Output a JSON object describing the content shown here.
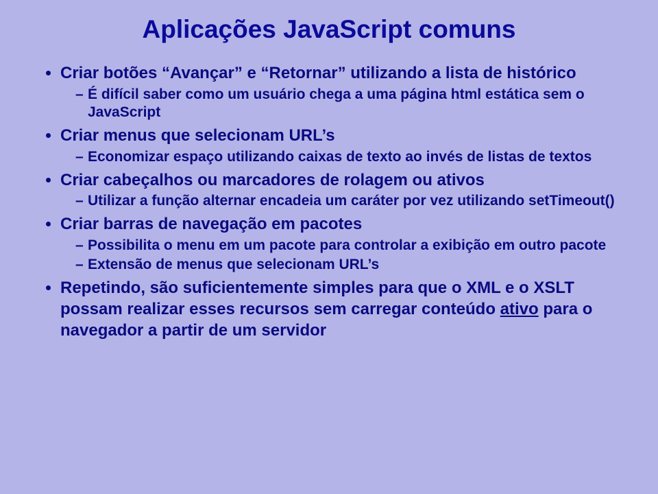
{
  "title": "Aplicações JavaScript comuns",
  "bullets": {
    "b1": {
      "text": "Criar botões “Avançar” e “Retornar” utilizando a lista de histórico",
      "s1": "É difícil saber como um usuário chega a uma página html estática sem o JavaScript"
    },
    "b2": {
      "text": "Criar menus que selecionam URL’s",
      "s1": "Economizar espaço utilizando caixas de texto ao invés de listas de textos"
    },
    "b3": {
      "text": "Criar cabeçalhos ou marcadores de rolagem ou ativos",
      "s1": "Utilizar a função alternar encadeia um caráter por vez utilizando setTimeout()"
    },
    "b4": {
      "text": "Criar barras de navegação em pacotes",
      "s1": "Possibilita o menu em um pacote para controlar a exibição em outro pacote",
      "s2": "Extensão de menus que selecionam URL’s"
    },
    "b5": {
      "pre": "Repetindo, são suficientemente simples para que o XML e o XSLT possam realizar esses recursos sem carregar conteúdo ",
      "underline": "ativo",
      "post": " para o navegador a partir de um servidor"
    }
  }
}
